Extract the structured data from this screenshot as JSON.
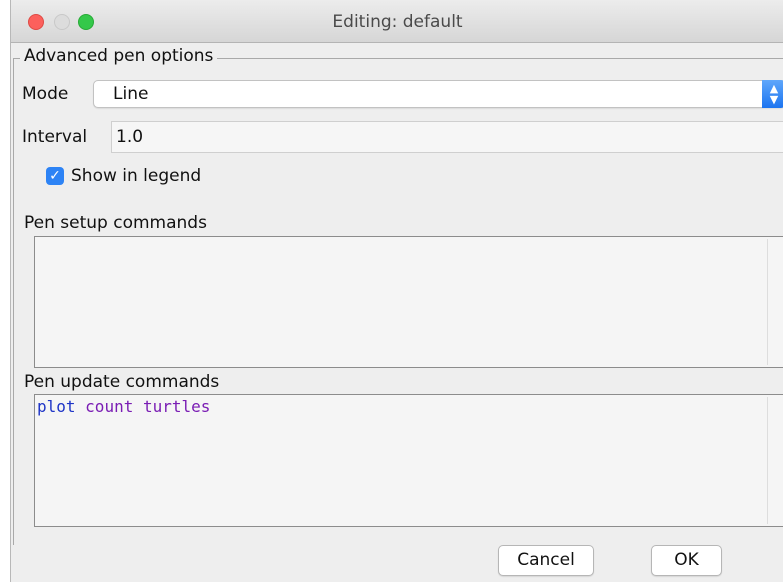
{
  "window": {
    "title": "Editing: default"
  },
  "group": {
    "legend": "Advanced pen options"
  },
  "mode": {
    "label": "Mode",
    "selected": "Line"
  },
  "interval": {
    "label": "Interval",
    "value": "1.0"
  },
  "legend_toggle": {
    "label": "Show in legend",
    "checked": true
  },
  "setup": {
    "label": "Pen setup commands",
    "code": ""
  },
  "update": {
    "label": "Pen update commands",
    "code_tokens": [
      "plot",
      "count turtles"
    ]
  },
  "buttons": {
    "cancel": "Cancel",
    "ok": "OK"
  },
  "colors": {
    "close": "#fc605c",
    "maximize": "#34c84a",
    "accent": "#2d83f5",
    "keyword": "#1d34c7",
    "reporter": "#7a1db4"
  }
}
